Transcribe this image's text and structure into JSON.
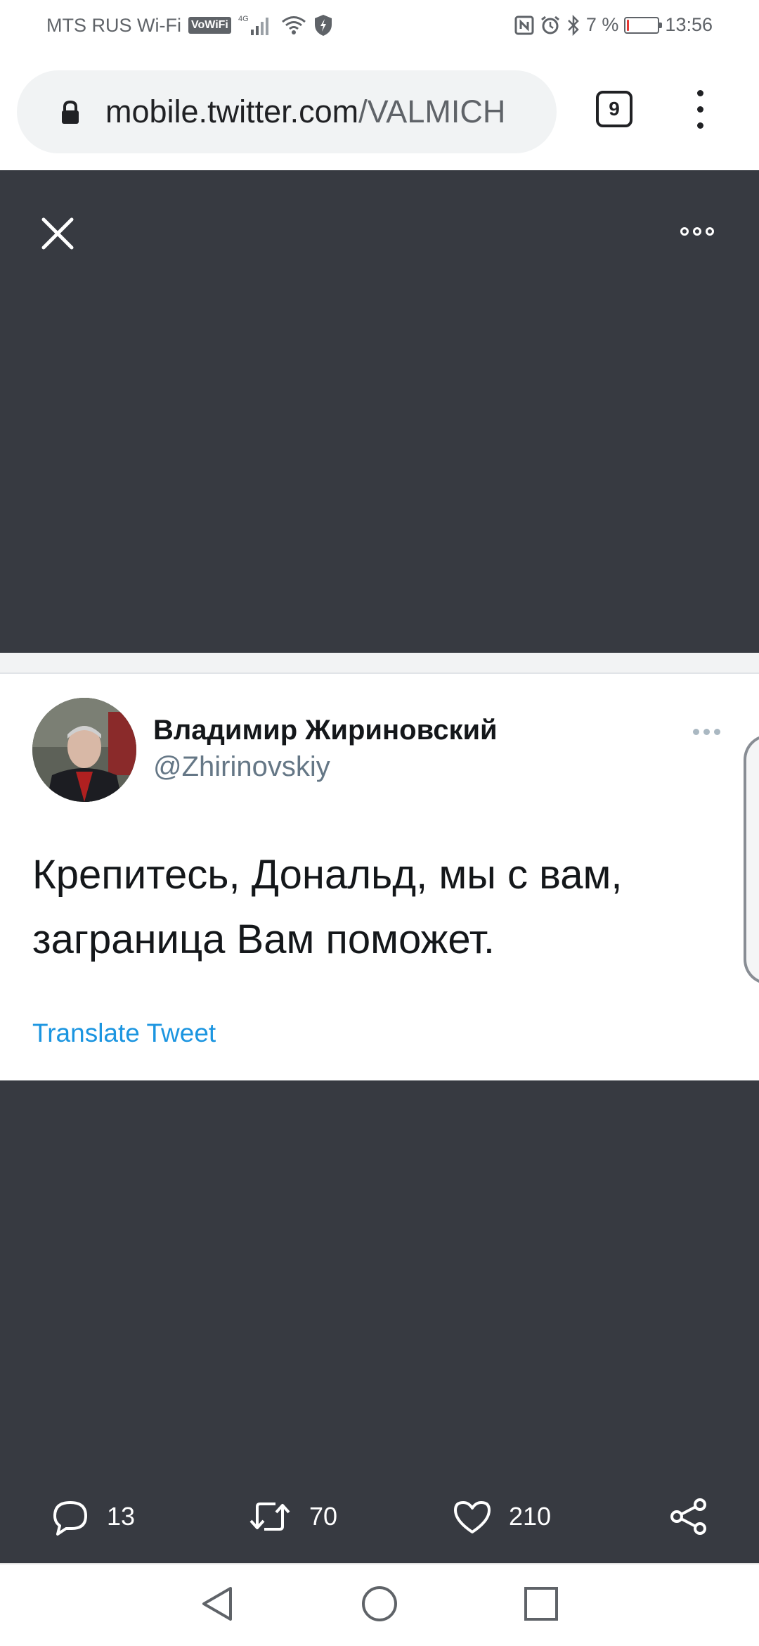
{
  "status_bar": {
    "carrier": "MTS RUS Wi-Fi",
    "vowifi": "VoWiFi",
    "network": "4G",
    "battery_text": "7 %",
    "battery_level": 0.07,
    "time": "13:56"
  },
  "browser": {
    "url_host": "mobile.twitter.com",
    "url_path": "/VALMICH",
    "tab_count": "9"
  },
  "tweet": {
    "display_name": "Владимир Жириновский",
    "handle": "@Zhirinovskiy",
    "text_line1": "Крепитесь, Дональд, мы с вам,",
    "text_line2": "заграница Вам поможет.",
    "translate_label": "Translate Tweet"
  },
  "actions": {
    "replies": "13",
    "retweets": "70",
    "likes": "210"
  },
  "colors": {
    "viewer_bg": "#373a41",
    "link": "#1b95e0",
    "battery_low": "#e53935"
  }
}
